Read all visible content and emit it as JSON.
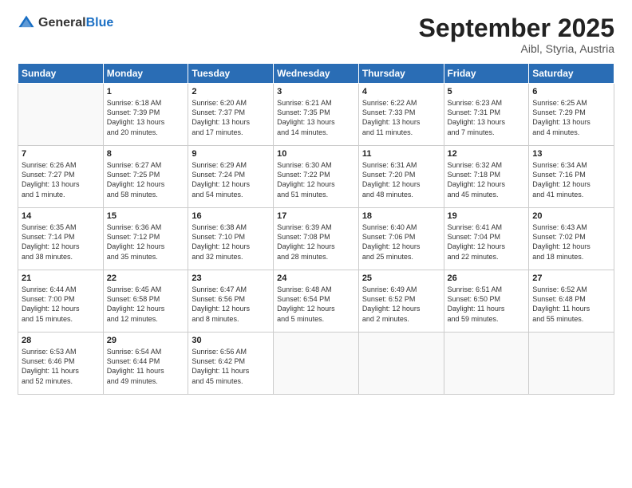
{
  "logo": {
    "general": "General",
    "blue": "Blue"
  },
  "title": "September 2025",
  "subtitle": "Aibl, Styria, Austria",
  "days_header": [
    "Sunday",
    "Monday",
    "Tuesday",
    "Wednesday",
    "Thursday",
    "Friday",
    "Saturday"
  ],
  "weeks": [
    [
      {
        "day": "",
        "content": ""
      },
      {
        "day": "1",
        "content": "Sunrise: 6:18 AM\nSunset: 7:39 PM\nDaylight: 13 hours\nand 20 minutes."
      },
      {
        "day": "2",
        "content": "Sunrise: 6:20 AM\nSunset: 7:37 PM\nDaylight: 13 hours\nand 17 minutes."
      },
      {
        "day": "3",
        "content": "Sunrise: 6:21 AM\nSunset: 7:35 PM\nDaylight: 13 hours\nand 14 minutes."
      },
      {
        "day": "4",
        "content": "Sunrise: 6:22 AM\nSunset: 7:33 PM\nDaylight: 13 hours\nand 11 minutes."
      },
      {
        "day": "5",
        "content": "Sunrise: 6:23 AM\nSunset: 7:31 PM\nDaylight: 13 hours\nand 7 minutes."
      },
      {
        "day": "6",
        "content": "Sunrise: 6:25 AM\nSunset: 7:29 PM\nDaylight: 13 hours\nand 4 minutes."
      }
    ],
    [
      {
        "day": "7",
        "content": "Sunrise: 6:26 AM\nSunset: 7:27 PM\nDaylight: 13 hours\nand 1 minute."
      },
      {
        "day": "8",
        "content": "Sunrise: 6:27 AM\nSunset: 7:25 PM\nDaylight: 12 hours\nand 58 minutes."
      },
      {
        "day": "9",
        "content": "Sunrise: 6:29 AM\nSunset: 7:24 PM\nDaylight: 12 hours\nand 54 minutes."
      },
      {
        "day": "10",
        "content": "Sunrise: 6:30 AM\nSunset: 7:22 PM\nDaylight: 12 hours\nand 51 minutes."
      },
      {
        "day": "11",
        "content": "Sunrise: 6:31 AM\nSunset: 7:20 PM\nDaylight: 12 hours\nand 48 minutes."
      },
      {
        "day": "12",
        "content": "Sunrise: 6:32 AM\nSunset: 7:18 PM\nDaylight: 12 hours\nand 45 minutes."
      },
      {
        "day": "13",
        "content": "Sunrise: 6:34 AM\nSunset: 7:16 PM\nDaylight: 12 hours\nand 41 minutes."
      }
    ],
    [
      {
        "day": "14",
        "content": "Sunrise: 6:35 AM\nSunset: 7:14 PM\nDaylight: 12 hours\nand 38 minutes."
      },
      {
        "day": "15",
        "content": "Sunrise: 6:36 AM\nSunset: 7:12 PM\nDaylight: 12 hours\nand 35 minutes."
      },
      {
        "day": "16",
        "content": "Sunrise: 6:38 AM\nSunset: 7:10 PM\nDaylight: 12 hours\nand 32 minutes."
      },
      {
        "day": "17",
        "content": "Sunrise: 6:39 AM\nSunset: 7:08 PM\nDaylight: 12 hours\nand 28 minutes."
      },
      {
        "day": "18",
        "content": "Sunrise: 6:40 AM\nSunset: 7:06 PM\nDaylight: 12 hours\nand 25 minutes."
      },
      {
        "day": "19",
        "content": "Sunrise: 6:41 AM\nSunset: 7:04 PM\nDaylight: 12 hours\nand 22 minutes."
      },
      {
        "day": "20",
        "content": "Sunrise: 6:43 AM\nSunset: 7:02 PM\nDaylight: 12 hours\nand 18 minutes."
      }
    ],
    [
      {
        "day": "21",
        "content": "Sunrise: 6:44 AM\nSunset: 7:00 PM\nDaylight: 12 hours\nand 15 minutes."
      },
      {
        "day": "22",
        "content": "Sunrise: 6:45 AM\nSunset: 6:58 PM\nDaylight: 12 hours\nand 12 minutes."
      },
      {
        "day": "23",
        "content": "Sunrise: 6:47 AM\nSunset: 6:56 PM\nDaylight: 12 hours\nand 8 minutes."
      },
      {
        "day": "24",
        "content": "Sunrise: 6:48 AM\nSunset: 6:54 PM\nDaylight: 12 hours\nand 5 minutes."
      },
      {
        "day": "25",
        "content": "Sunrise: 6:49 AM\nSunset: 6:52 PM\nDaylight: 12 hours\nand 2 minutes."
      },
      {
        "day": "26",
        "content": "Sunrise: 6:51 AM\nSunset: 6:50 PM\nDaylight: 11 hours\nand 59 minutes."
      },
      {
        "day": "27",
        "content": "Sunrise: 6:52 AM\nSunset: 6:48 PM\nDaylight: 11 hours\nand 55 minutes."
      }
    ],
    [
      {
        "day": "28",
        "content": "Sunrise: 6:53 AM\nSunset: 6:46 PM\nDaylight: 11 hours\nand 52 minutes."
      },
      {
        "day": "29",
        "content": "Sunrise: 6:54 AM\nSunset: 6:44 PM\nDaylight: 11 hours\nand 49 minutes."
      },
      {
        "day": "30",
        "content": "Sunrise: 6:56 AM\nSunset: 6:42 PM\nDaylight: 11 hours\nand 45 minutes."
      },
      {
        "day": "",
        "content": ""
      },
      {
        "day": "",
        "content": ""
      },
      {
        "day": "",
        "content": ""
      },
      {
        "day": "",
        "content": ""
      }
    ]
  ]
}
